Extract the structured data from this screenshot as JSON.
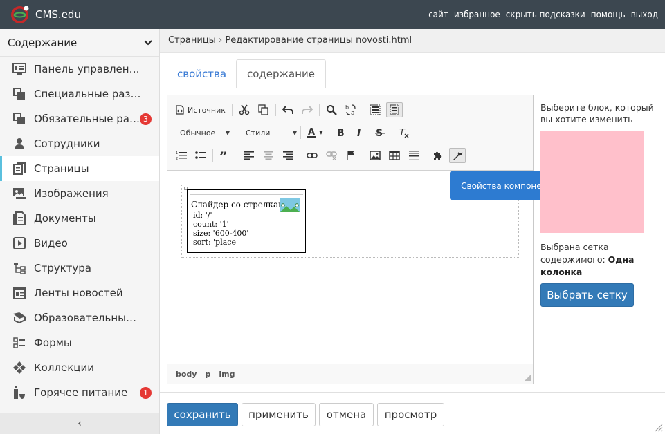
{
  "app": {
    "title": "CMS.edu"
  },
  "topnav": [
    "сайт",
    "избранное",
    "скрыть подсказки",
    "помощь",
    "выход"
  ],
  "sidebar": {
    "header": "Содержание",
    "items": [
      {
        "label": "Панель управления",
        "icon": "dashboard-icon"
      },
      {
        "label": "Специальные разделы",
        "icon": "copy-icon"
      },
      {
        "label": "Обязательные разделы",
        "icon": "copy-icon",
        "badge": "3"
      },
      {
        "label": "Сотрудники",
        "icon": "user-icon"
      },
      {
        "label": "Страницы",
        "icon": "page-icon",
        "active": true
      },
      {
        "label": "Изображения",
        "icon": "images-icon"
      },
      {
        "label": "Документы",
        "icon": "documents-icon"
      },
      {
        "label": "Видео",
        "icon": "video-icon"
      },
      {
        "label": "Структура",
        "icon": "structure-icon"
      },
      {
        "label": "Ленты новостей",
        "icon": "newsfeed-icon"
      },
      {
        "label": "Образовательные программы",
        "icon": "education-icon"
      },
      {
        "label": "Формы",
        "icon": "forms-icon"
      },
      {
        "label": "Коллекции",
        "icon": "collections-icon"
      },
      {
        "label": "Горячее питание",
        "icon": "food-icon",
        "badge": "1"
      }
    ],
    "collapse": "‹"
  },
  "breadcrumb": "Страницы › Редактирование страницы novosti.html",
  "tabs": [
    "свойства",
    "содержание"
  ],
  "editor": {
    "source_label": "Источник",
    "format_combo": "Обычное",
    "styles_combo": "Стили",
    "widget": {
      "title": "Слайдер со стрелками",
      "lines": [
        "id: '/'",
        "count: '1'",
        "size: '600-400'",
        "sort: 'place'"
      ]
    },
    "path": [
      "body",
      "p",
      "img"
    ],
    "tooltip": "Свойства компонента"
  },
  "rightpanel": {
    "select_block": "Выберите блок, который вы хотите изменить",
    "grid_prefix": "Выбрана сетка содержимого:",
    "grid_value": "Одна колонка",
    "grid_button": "Выбрать сетку"
  },
  "footer": {
    "save": "сохранить",
    "apply": "применить",
    "cancel": "отмена",
    "preview": "просмотр"
  },
  "colors": {
    "topbar": "#3c4750",
    "accent": "#337ab7",
    "badge": "#e53935",
    "pink": "#ffc0cb",
    "active_bar": "#5bc0de"
  }
}
